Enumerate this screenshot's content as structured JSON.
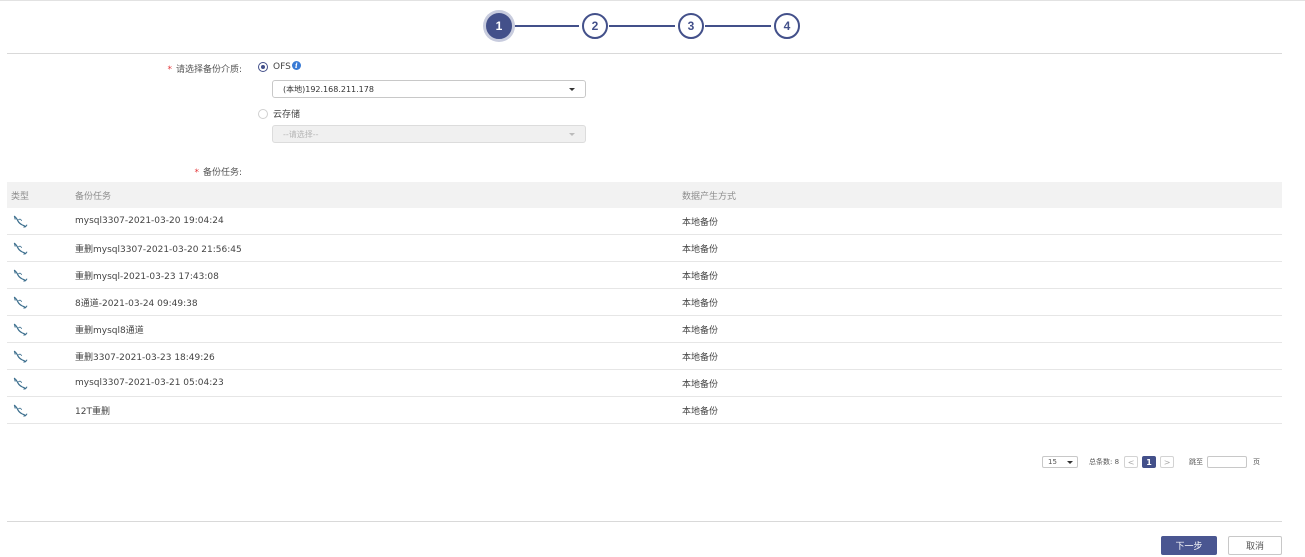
{
  "stepper": {
    "steps": [
      "1",
      "2",
      "3",
      "4"
    ],
    "active_index": 0,
    "accent": "#43508a"
  },
  "form": {
    "media_label": "请选择备份介质:",
    "options": [
      {
        "label": "OFS",
        "checked": true,
        "info_icon": "info-icon",
        "select_value": "(本地)192.168.211.178"
      },
      {
        "label": "云存储",
        "checked": false,
        "select_placeholder": "--请选择--"
      }
    ],
    "task_label": "备份任务:"
  },
  "table": {
    "columns": [
      "类型",
      "备份任务",
      "数据产生方式"
    ],
    "type_icon": "mysql-dolphin-icon",
    "rows": [
      {
        "task": "mysql3307-2021-03-20 19:04:24",
        "method": "本地备份"
      },
      {
        "task": "重删mysql3307-2021-03-20 21:56:45",
        "method": "本地备份"
      },
      {
        "task": "重删mysql-2021-03-23 17:43:08",
        "method": "本地备份"
      },
      {
        "task": "8通道-2021-03-24 09:49:38",
        "method": "本地备份"
      },
      {
        "task": "重删mysql8通道",
        "method": "本地备份"
      },
      {
        "task": "重删3307-2021-03-23 18:49:26",
        "method": "本地备份"
      },
      {
        "task": "mysql3307-2021-03-21 05:04:23",
        "method": "本地备份"
      },
      {
        "task": "12T重删",
        "method": "本地备份"
      }
    ]
  },
  "pagination": {
    "page_size": "15",
    "total_label": "总条数: 8",
    "prev": "<",
    "current_page": "1",
    "next": ">",
    "jump_label": "跳至",
    "page_suffix": "页"
  },
  "footer": {
    "next_label": "下一步",
    "cancel_label": "取消"
  }
}
